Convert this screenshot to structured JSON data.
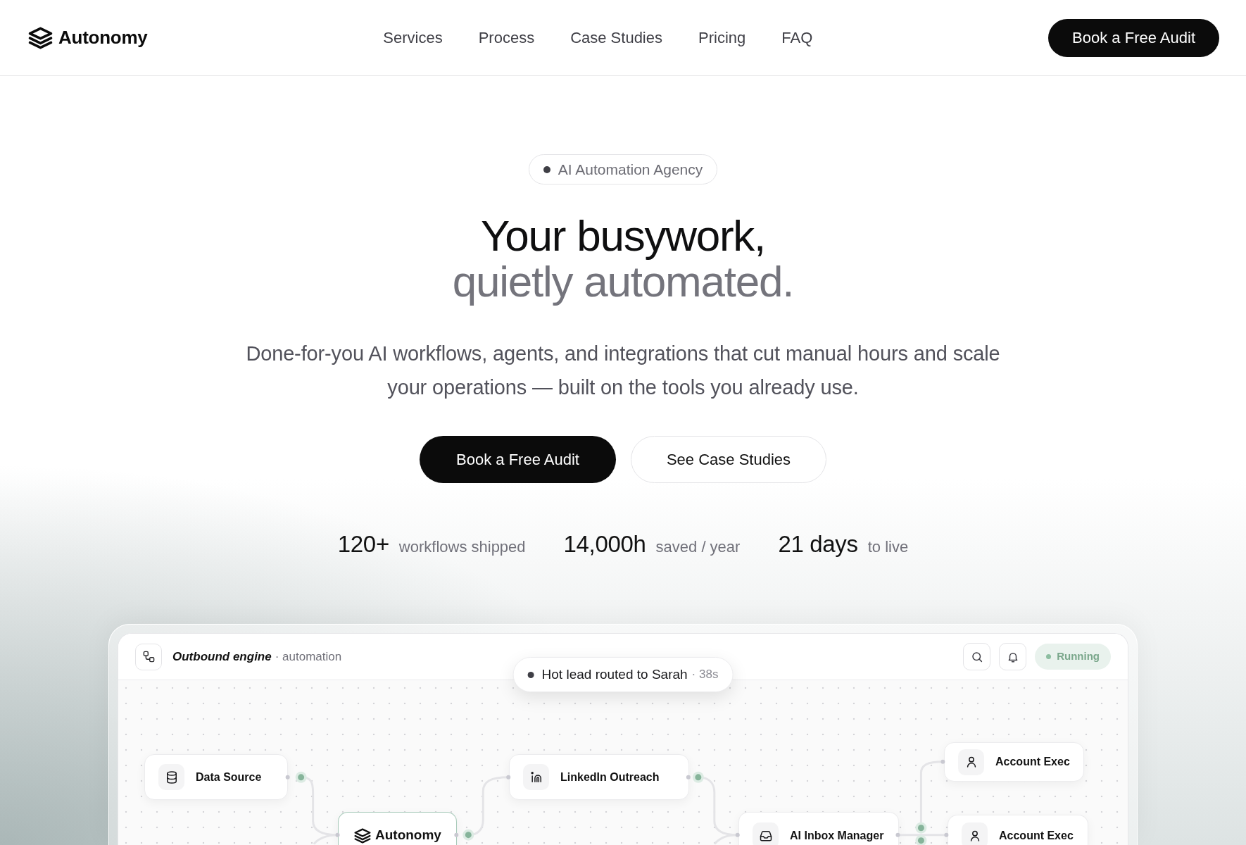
{
  "header": {
    "brand": "Autonomy",
    "nav": [
      "Services",
      "Process",
      "Case Studies",
      "Pricing",
      "FAQ"
    ],
    "cta": "Book a Free Audit"
  },
  "hero": {
    "badge": "AI Automation Agency",
    "title": "Your busywork,",
    "title_accent": "quietly automated.",
    "description": "Done-for-you AI workflows, agents, and integrations that cut manual hours and scale your operations — built on the tools you already use.",
    "buttons": [
      {
        "label": "Book a Free Audit",
        "kind": "primary"
      },
      {
        "label": "See Case Studies",
        "kind": "secondary"
      }
    ],
    "stats": [
      {
        "value": "120+",
        "label": "workflows shipped"
      },
      {
        "value": "14,000h",
        "label": "saved / year"
      },
      {
        "value": "21 days",
        "label": "to live"
      }
    ]
  },
  "workflow": {
    "title": "Outbound engine",
    "subtitle": "· automation",
    "status": "Running",
    "toast": {
      "message": "Hot lead routed to Sarah",
      "time": "· 38s"
    },
    "nodes": [
      {
        "label": "Data Source",
        "kind": "data"
      },
      {
        "label": "Autonomy",
        "kind": "hub"
      },
      {
        "label": "LinkedIn Outreach",
        "kind": "outreach"
      },
      {
        "label": "AI Inbox Manager",
        "kind": "inbox"
      },
      {
        "label": "Account Exec",
        "kind": "person"
      },
      {
        "label": "Account Exec",
        "kind": "person"
      }
    ]
  }
}
